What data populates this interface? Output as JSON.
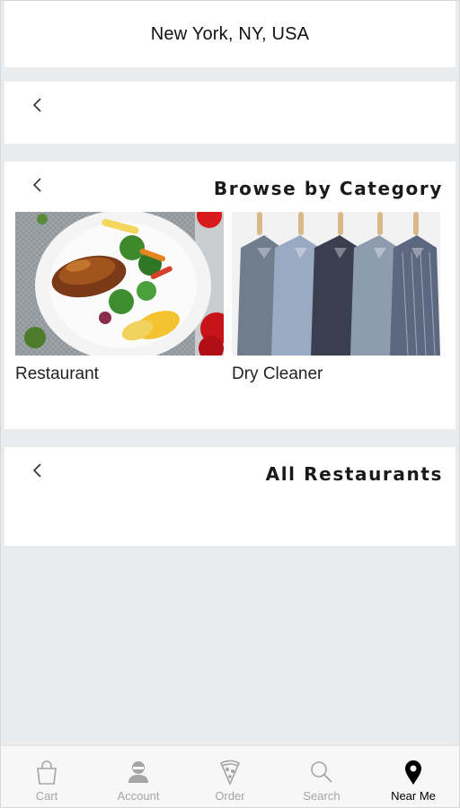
{
  "header": {
    "location": "New York, NY, USA"
  },
  "sections": {
    "top": {
      "title": ""
    },
    "browse": {
      "title": "Browse by Category",
      "categories": [
        {
          "label": "Restaurant",
          "image": "plated-chicken-salad"
        },
        {
          "label": "Dry Cleaner",
          "image": "shirts-on-hangers"
        }
      ]
    },
    "all": {
      "title": "All Restaurants"
    }
  },
  "tabbar": {
    "active": "Near Me",
    "items": [
      {
        "label": "Cart",
        "icon": "shopping-bag-icon"
      },
      {
        "label": "Account",
        "icon": "account-icon"
      },
      {
        "label": "Order",
        "icon": "pizza-slice-icon"
      },
      {
        "label": "Search",
        "icon": "search-icon"
      },
      {
        "label": "Near Me",
        "icon": "map-pin-icon"
      }
    ]
  },
  "colors": {
    "background": "#eaebec",
    "card": "#ffffff",
    "tab_inactive": "#a5a5a5",
    "tab_active": "#000000"
  }
}
